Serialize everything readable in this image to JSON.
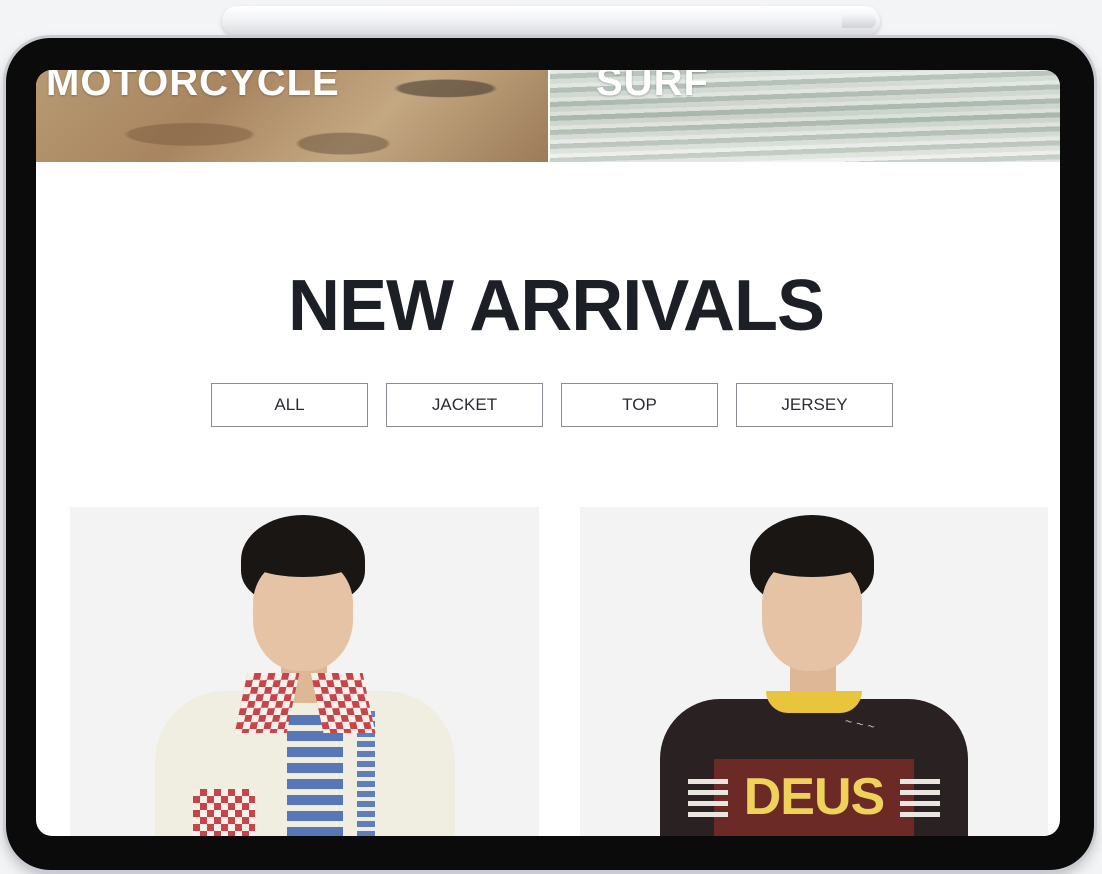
{
  "banners": [
    {
      "label": "MOTORCYCLE"
    },
    {
      "label": "SURF"
    }
  ],
  "section": {
    "title": "NEW ARRIVALS"
  },
  "filters": [
    {
      "label": "ALL"
    },
    {
      "label": "JACKET"
    },
    {
      "label": "TOP"
    },
    {
      "label": "JERSEY"
    }
  ],
  "products": [
    {
      "image": "model-cream-jacket-photo"
    },
    {
      "image": "model-dark-jersey-photo",
      "logo_text": "DEUS"
    }
  ],
  "colors": {
    "heading": "#1c1f26",
    "filter_border": "#8a8d93",
    "card_background": "#f3f3f3",
    "device_bezel": "#0b0b0c"
  }
}
